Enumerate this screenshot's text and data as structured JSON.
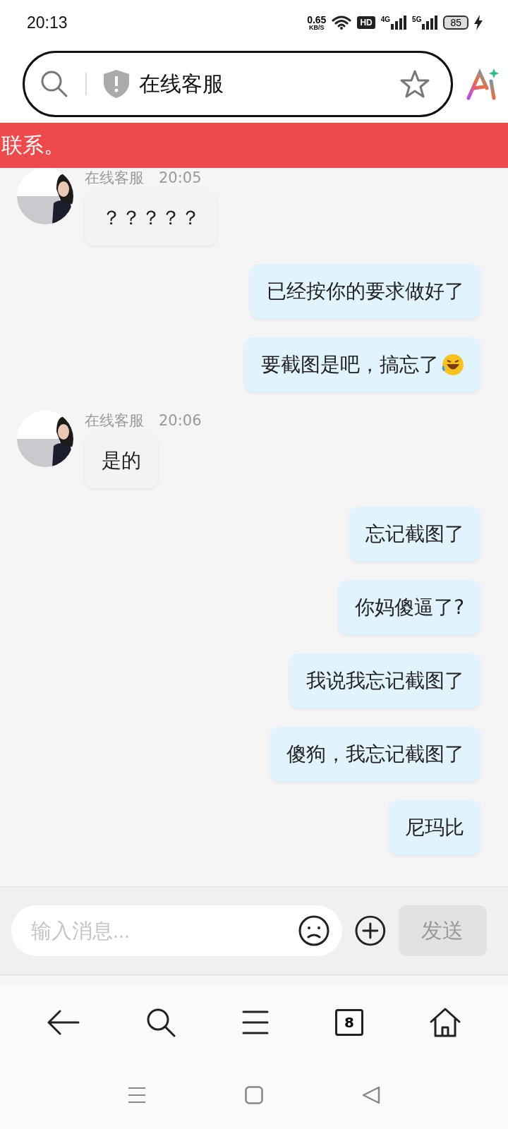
{
  "status_bar": {
    "time": "20:13",
    "speed": "0.65",
    "speed_unit": "KB/S",
    "hd": "HD",
    "networks": [
      "4G",
      "5G"
    ],
    "battery": "85"
  },
  "address_bar": {
    "title": "在线客服"
  },
  "banner": {
    "text": "联系。"
  },
  "messages": [
    {
      "kind": "agent",
      "name": "在线客服",
      "time": "20:05",
      "text": "？？？？？"
    },
    {
      "kind": "user",
      "text": "已经按你的要求做好了",
      "emoji": false
    },
    {
      "kind": "user",
      "text": "要截图是吧，搞忘了",
      "emoji": true
    },
    {
      "kind": "agent",
      "name": "在线客服",
      "time": "20:06",
      "text": "是的"
    },
    {
      "kind": "user",
      "text": "忘记截图了",
      "emoji": false
    },
    {
      "kind": "user",
      "text": "你妈傻逼了?",
      "emoji": false
    },
    {
      "kind": "user",
      "text": "我说我忘记截图了",
      "emoji": false
    },
    {
      "kind": "user",
      "text": "傻狗，我忘记截图了",
      "emoji": false
    },
    {
      "kind": "user",
      "text": "尼玛比",
      "emoji": false
    }
  ],
  "composer": {
    "placeholder": "输入消息...",
    "send": "发送",
    "send_disabled": true
  },
  "toolbar": {
    "tab_count": "8"
  }
}
